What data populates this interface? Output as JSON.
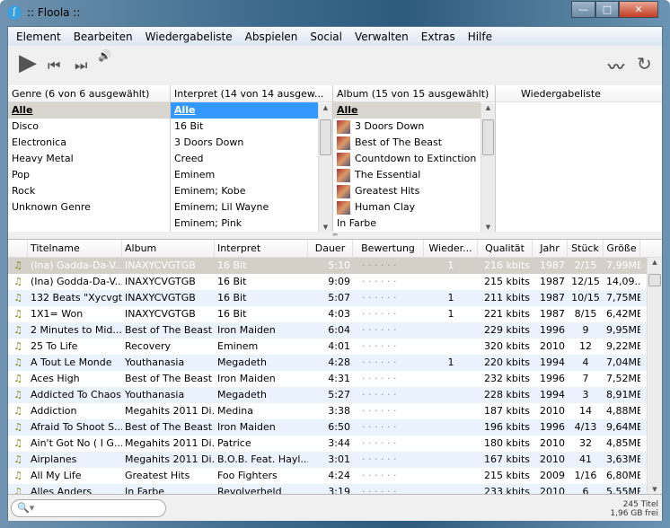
{
  "window": {
    "title": ":: Floola ::",
    "minimize": "—",
    "maximize": "□",
    "close": "✕"
  },
  "menu": [
    "Element",
    "Bearbeiten",
    "Wiedergabeliste",
    "Abspielen",
    "Social",
    "Verwalten",
    "Extras",
    "Hilfe"
  ],
  "toolbar": {
    "play": "▶",
    "prev": "⏮",
    "next": "⏭",
    "volume": "🔊",
    "effects": "〰",
    "refresh": "↻"
  },
  "panes": {
    "genre": {
      "header": "Genre (6 von 6 ausgewählt)",
      "items": [
        "Alle",
        "Disco",
        "Electronica",
        "Heavy Metal",
        "Pop",
        "Rock",
        "Unknown Genre"
      ]
    },
    "interpret": {
      "header": "Interpret (14 von 14 ausgew...",
      "items": [
        "Alle",
        "16 Bit",
        "3 Doors Down",
        "Creed",
        "Eminem",
        "Eminem; Kobe",
        "Eminem; Lil Wayne",
        "Eminem; Pink"
      ]
    },
    "album": {
      "header": "Album (15 von 15 ausgewählt)",
      "items": [
        "Alle",
        "3 Doors Down",
        "Best of The Beast",
        "Countdown to Extinction",
        "The Essential",
        "Greatest Hits",
        "Human Clay",
        "In Farbe"
      ]
    },
    "playlist": {
      "header": "Wiedergabeliste"
    }
  },
  "tracks": {
    "columns": [
      "",
      "Titelname",
      "Album",
      "Interpret",
      "Dauer",
      "Bewertung",
      "Wieder...",
      "Qualität",
      "Jahr",
      "Stück",
      "Größe"
    ],
    "rating_placeholder": "·  ·  ·  ·  ·  ·",
    "rows": [
      [
        "(Ina) Gadda-Da-V...",
        "INAXYCVGTGB",
        "16 Bit",
        "5:10",
        "1",
        "216 kbits",
        "1987",
        "2/15",
        "7,99MB"
      ],
      [
        "(Ina) Godda-Da-V...",
        "INAXYCVGTGB",
        "16 Bit",
        "9:09",
        "",
        "215 kbits",
        "1987",
        "12/15",
        "14,09..."
      ],
      [
        "132 Beats \"Xycvgt...",
        "INAXYCVGTGB",
        "16 Bit",
        "5:07",
        "1",
        "211 kbits",
        "1987",
        "10/15",
        "7,75MB"
      ],
      [
        "1X1= Won",
        "INAXYCVGTGB",
        "16 Bit",
        "4:03",
        "1",
        "221 kbits",
        "1987",
        "8/15",
        "6,42MB"
      ],
      [
        "2 Minutes to Mid...",
        "Best of The Beast",
        "Iron Maiden",
        "6:04",
        "",
        "229 kbits",
        "1996",
        "9",
        "9,95MB"
      ],
      [
        "25 To Life",
        "Recovery",
        "Eminem",
        "4:01",
        "",
        "320 kbits",
        "2010",
        "12",
        "9,22MB"
      ],
      [
        "A Tout Le Monde",
        "Youthanasia",
        "Megadeth",
        "4:28",
        "1",
        "220 kbits",
        "1994",
        "4",
        "7,04MB"
      ],
      [
        "Aces High",
        "Best of The Beast",
        "Iron Maiden",
        "4:31",
        "",
        "232 kbits",
        "1996",
        "7",
        "7,52MB"
      ],
      [
        "Addicted To Chaos",
        "Youthanasia",
        "Megadeth",
        "5:27",
        "",
        "228 kbits",
        "1994",
        "3",
        "8,91MB"
      ],
      [
        "Addiction",
        "Megahits 2011 Di...",
        "Medina",
        "3:38",
        "",
        "187 kbits",
        "2010",
        "14",
        "4,88MB"
      ],
      [
        "Afraid To Shoot S...",
        "Best of The Beast",
        "Iron Maiden",
        "6:50",
        "",
        "196 kbits",
        "1996",
        "4/13",
        "9,64MB"
      ],
      [
        "Ain't Got No ( I G...",
        "Megahits 2011 Di...",
        "Patrice",
        "3:44",
        "",
        "180 kbits",
        "2010",
        "32",
        "4,85MB"
      ],
      [
        "Airplanes",
        "Megahits 2011 Di...",
        "B.O.B. Feat. Hayl...",
        "3:01",
        "",
        "167 kbits",
        "2010",
        "41",
        "3,63MB"
      ],
      [
        "All My Life",
        "Greatest Hits",
        "Foo Fighters",
        "4:24",
        "",
        "215 kbits",
        "2009",
        "1/16",
        "6,80MB"
      ],
      [
        "Alles Anders",
        "In Farbe",
        "Revolverheld",
        "3:19",
        "",
        "233 kbits",
        "2010",
        "6",
        "5,55MB"
      ]
    ]
  },
  "status": {
    "search_placeholder": "🔍▾",
    "count": "245 Titel",
    "free": "1,96 GB frei"
  }
}
